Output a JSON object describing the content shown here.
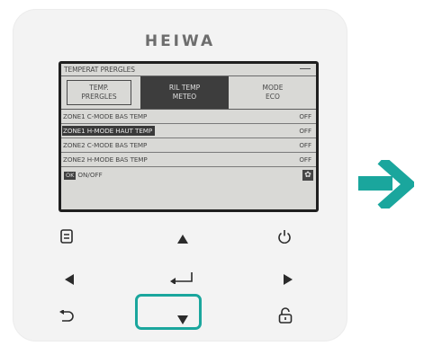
{
  "brand": "HEIWA",
  "lcd": {
    "title": "TEMPERAT PRERGLES",
    "tabs": [
      {
        "label": "TEMP.\nPRERGLES"
      },
      {
        "label": "RIL TEMP\nMETEO"
      },
      {
        "label": "MODE\nECO"
      }
    ],
    "rows": [
      {
        "label": "ZONE1 C-MODE BAS TEMP",
        "value": "OFF"
      },
      {
        "label": "ZONE1 H-MODE HAUT TEMP",
        "value": "OFF"
      },
      {
        "label": "ZONE2 C-MODE BAS TEMP",
        "value": "OFF"
      },
      {
        "label": "ZONE2 H-MODE BAS TEMP",
        "value": "OFF"
      }
    ],
    "footer": {
      "badge": "OK",
      "label": "ON/OFF"
    }
  },
  "colors": {
    "accent": "#1aa69d",
    "screen": "#d9d9d6",
    "device": "#f3f3f3"
  },
  "buttons": [
    "menu-icon",
    "up-arrow-icon",
    "power-icon",
    "left-arrow-icon",
    "enter-icon",
    "right-arrow-icon",
    "back-icon",
    "down-arrow-icon",
    "unlock-icon"
  ]
}
